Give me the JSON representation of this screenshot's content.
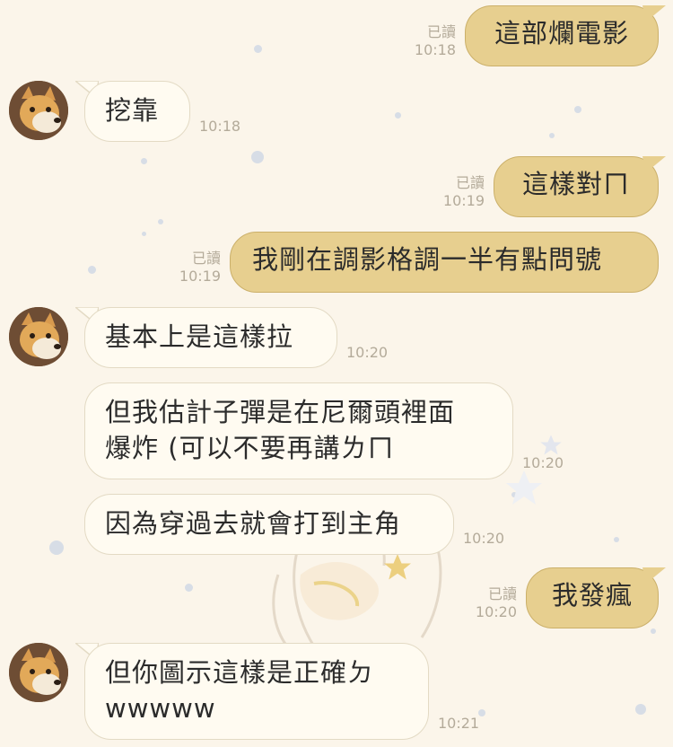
{
  "messages": [
    {
      "id": "m1",
      "side": "out",
      "read": "已讀",
      "time": "10:18",
      "lines": [
        "這部爛電影"
      ]
    },
    {
      "id": "m2",
      "side": "in",
      "time": "10:18",
      "lines": [
        "挖靠"
      ]
    },
    {
      "id": "m3",
      "side": "out",
      "read": "已讀",
      "time": "10:19",
      "lines": [
        "這樣對ㄇ"
      ]
    },
    {
      "id": "m4",
      "side": "out",
      "read": "已讀",
      "time": "10:19",
      "lines": [
        "我剛在調影格調一半有點問號"
      ]
    },
    {
      "id": "m5",
      "side": "in",
      "time": "10:20",
      "lines": [
        "基本上是這樣拉"
      ]
    },
    {
      "id": "m6",
      "side": "in",
      "time": "10:20",
      "lines": [
        "但我估計子彈是在尼爾頭裡面",
        "爆炸 (可以不要再講ㄌㄇ"
      ]
    },
    {
      "id": "m7",
      "side": "in",
      "time": "10:20",
      "lines": [
        "因為穿過去就會打到主角"
      ]
    },
    {
      "id": "m8",
      "side": "out",
      "read": "已讀",
      "time": "10:20",
      "lines": [
        "我發瘋"
      ]
    },
    {
      "id": "m9",
      "side": "in",
      "time": "10:21",
      "lines": [
        "但你圖示這樣是正確ㄉ",
        "wwwww"
      ]
    }
  ],
  "colors": {
    "background": "#fbf5ea",
    "outgoing_bubble": "#e7cf8f",
    "incoming_bubble": "#fffbf1",
    "meta_text": "#b4ab9a"
  },
  "icons": {
    "avatar": "shiba-dog-avatar",
    "star": "star-icon"
  }
}
